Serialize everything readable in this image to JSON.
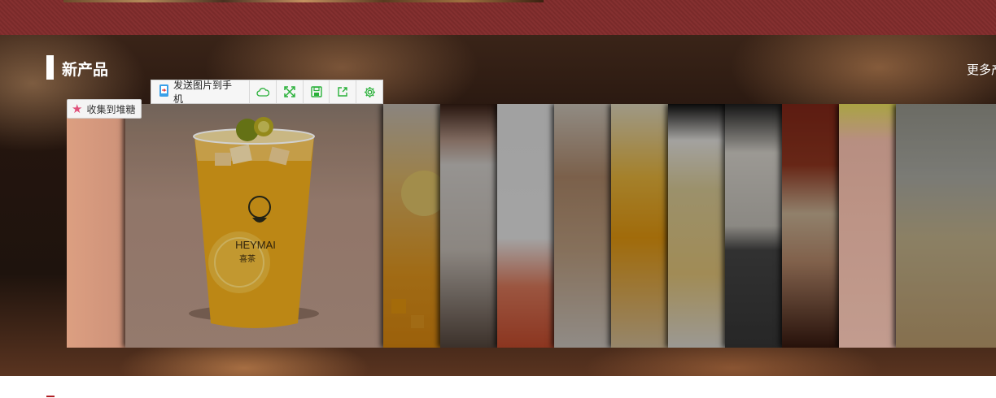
{
  "section": {
    "title": "新产品",
    "more_link": "更多产品"
  },
  "image_toolbar": {
    "send_to_phone_label": "发送图片到手机",
    "buttons": [
      "cloud-icon",
      "fullscreen-icon",
      "save-icon",
      "share-icon",
      "settings-icon"
    ]
  },
  "collect_button": {
    "label": "收集到堆糖",
    "icon": "star-icon"
  },
  "featured_product": {
    "brand": "HEYMAI",
    "brand_cn": "喜茶"
  },
  "gallery": {
    "panel_count": 15
  },
  "colors": {
    "top_band": "#7f2c2c",
    "toolbar_icon": "#2ab13a",
    "collect_star": "#e0507a",
    "accent_red": "#b01f24"
  }
}
